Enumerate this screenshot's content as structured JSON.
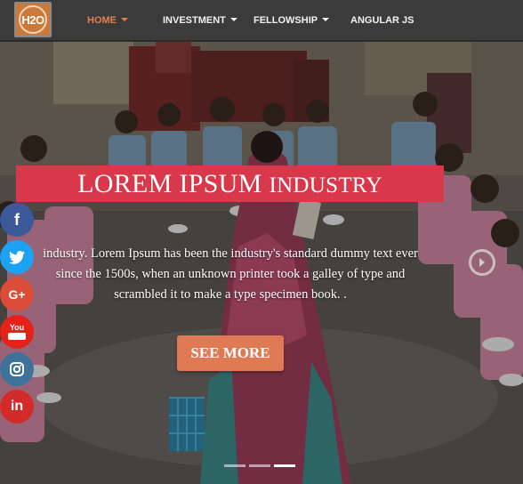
{
  "brand": {
    "logo_text": "H2O"
  },
  "nav": {
    "items": [
      {
        "label": "HOME",
        "active": true,
        "dropdown": true
      },
      {
        "label": "INVESTMENT",
        "active": false,
        "dropdown": true
      },
      {
        "label": "FELLOWSHIP",
        "active": false,
        "dropdown": true
      },
      {
        "label": "ANGULAR JS",
        "active": false,
        "dropdown": false
      }
    ]
  },
  "hero": {
    "title_main": "LOREM IPSUM",
    "title_small": "INDUSTRY",
    "description": "industry. Lorem Ipsum has been the industry's standard dummy text ever since the 1500s, when an unknown printer took a galley of type and scrambled it to make a type specimen book. .",
    "cta_label": "SEE MORE",
    "slides_total": 3,
    "active_slide": 2
  },
  "social": [
    {
      "name": "facebook",
      "glyph": "f",
      "color": "#3b5998"
    },
    {
      "name": "twitter",
      "glyph": "",
      "color": "#1da1f2"
    },
    {
      "name": "google-plus",
      "glyph": "G+",
      "color": "#dd4b39"
    },
    {
      "name": "youtube",
      "glyph": "You",
      "color": "#e62117"
    },
    {
      "name": "instagram",
      "glyph": "",
      "color": "#3f729b"
    },
    {
      "name": "linkedin",
      "glyph": "in",
      "color": "#d32a2a"
    }
  ],
  "colors": {
    "navbar": "#3b3b3b",
    "nav_active": "#e3814e",
    "title_banner": "#d8384a",
    "cta": "#e07a55"
  }
}
